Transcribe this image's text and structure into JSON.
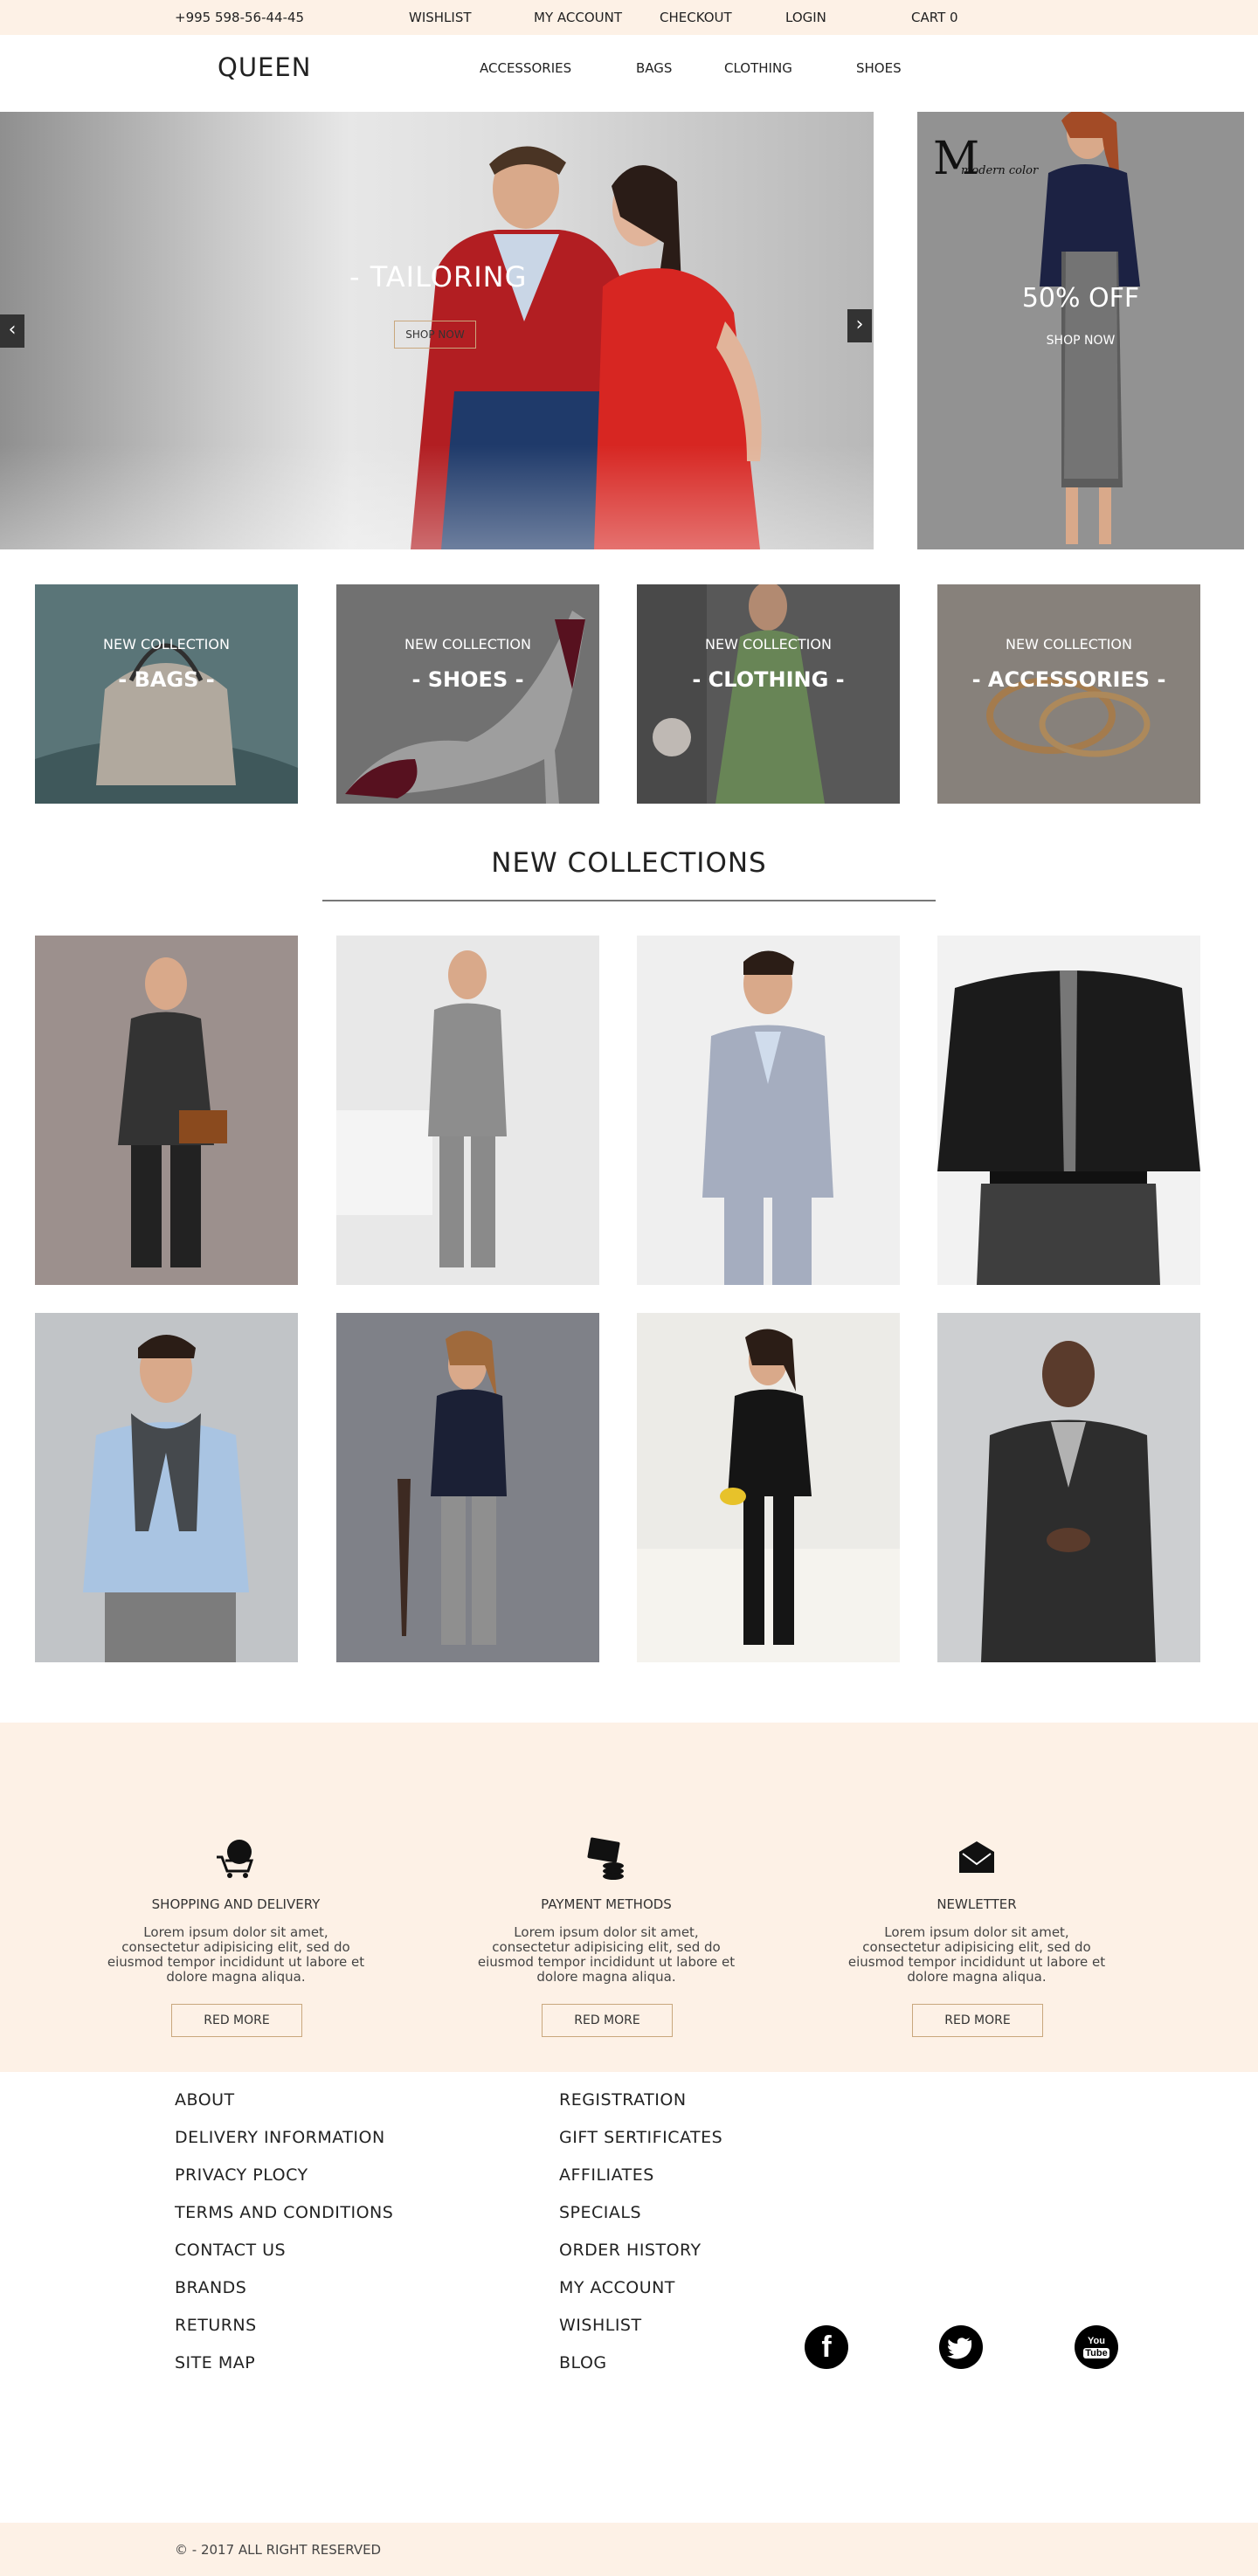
{
  "topbar": {
    "phone": "+995 598-56-44-45",
    "links": [
      "WISHLIST",
      "MY ACCOUNT",
      "CHECKOUT",
      "LOGIN",
      "CART 0"
    ]
  },
  "header": {
    "logo": "QUEEN",
    "nav": [
      "ACCESSORIES",
      "BAGS",
      "CLOTHING",
      "SHOES"
    ]
  },
  "hero": {
    "title": "- TAILORING",
    "button": "SHOP NOW",
    "prev": "‹",
    "next": "›"
  },
  "promo": {
    "logo_letter": "M",
    "logo_sub": "modern color",
    "title": "50% OFF",
    "link": "SHOP NOW"
  },
  "categories": [
    {
      "small": "NEW COLLECTION",
      "big": "- BAGS -"
    },
    {
      "small": "NEW COLLECTION",
      "big": "- SHOES -"
    },
    {
      "small": "NEW COLLECTION",
      "big": "- CLOTHING -"
    },
    {
      "small": "NEW COLLECTION",
      "big": "- ACCESSORIES -"
    }
  ],
  "collections": {
    "title": "NEW COLLECTIONS"
  },
  "features": [
    {
      "title": "SHOPPING AND DELIVERY",
      "text": "Lorem ipsum dolor sit amet, consectetur adipisicing elit, sed do eiusmod tempor incididunt ut labore et dolore magna aliqua.",
      "button": "RED MORE",
      "icon": "cart-icon"
    },
    {
      "title": "PAYMENT METHODS",
      "text": "Lorem ipsum dolor sit amet, consectetur adipisicing elit, sed do eiusmod tempor incididunt ut labore et dolore magna aliqua.",
      "button": "RED MORE",
      "icon": "payment-icon"
    },
    {
      "title": "NEWLETTER",
      "text": "Lorem ipsum dolor sit amet, consectetur adipisicing elit, sed do eiusmod tempor incididunt ut labore et dolore magna aliqua.",
      "button": "RED MORE",
      "icon": "envelope-icon"
    }
  ],
  "footer": {
    "col1": [
      "ABOUT",
      "DELIVERY INFORMATION",
      "PRIVACY PLOCY",
      "TERMS AND CONDITIONS",
      "CONTACT US",
      "BRANDS",
      "RETURNS",
      "SITE MAP"
    ],
    "col2": [
      "REGISTRATION",
      "GIFT SERTIFICATES",
      "AFFILIATES",
      "SPECIALS",
      "ORDER HISTORY",
      "MY ACCOUNT",
      "WISHLIST",
      "BLOG"
    ],
    "social": {
      "facebook": "f",
      "youtube_top": "You",
      "youtube_bottom": "Tube"
    },
    "copyright": "© - 2017 ALL RIGHT RESERVED"
  },
  "colors": {
    "accent_bg": "#fdf1e6",
    "button_border": "#c9a77d"
  }
}
